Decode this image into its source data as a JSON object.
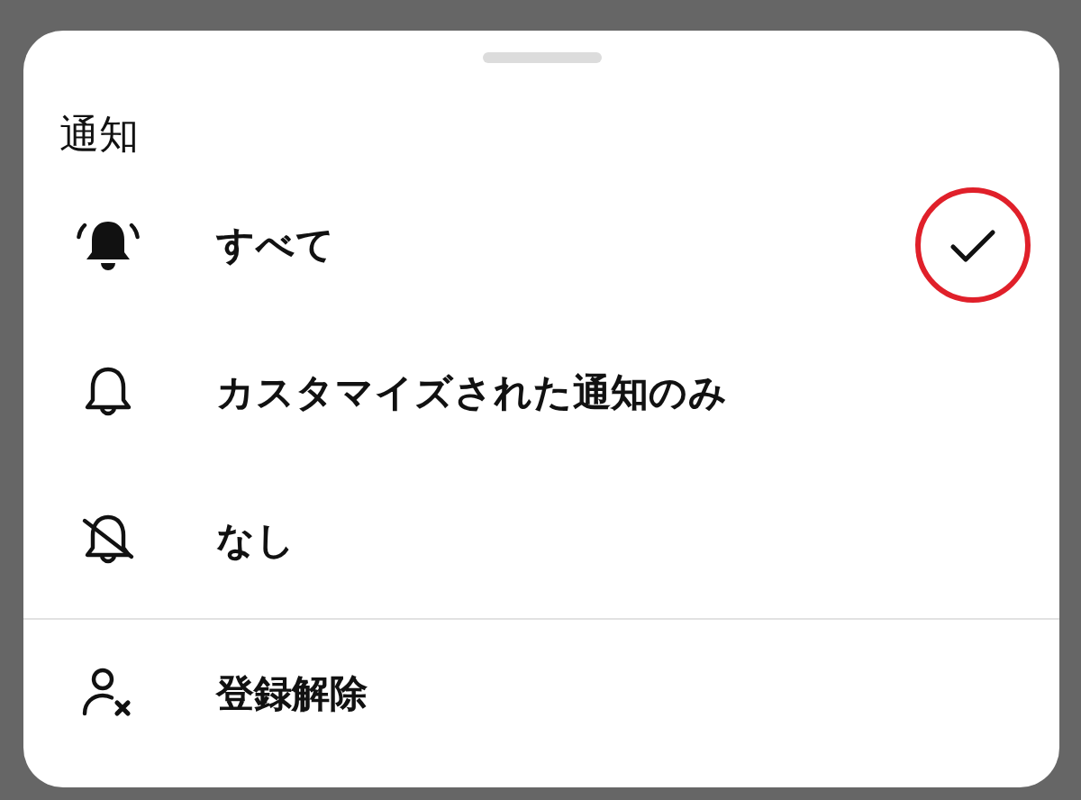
{
  "sheet": {
    "title": "通知",
    "options": [
      {
        "label": "すべて",
        "kind": "bell-ringing",
        "selected": true,
        "circled": true
      },
      {
        "label": "カスタマイズされた通知のみ",
        "kind": "bell",
        "selected": false,
        "circled": false
      },
      {
        "label": "なし",
        "kind": "bell-off",
        "selected": false,
        "circled": false
      }
    ],
    "actions": [
      {
        "label": "登録解除",
        "kind": "unsubscribe"
      }
    ]
  }
}
